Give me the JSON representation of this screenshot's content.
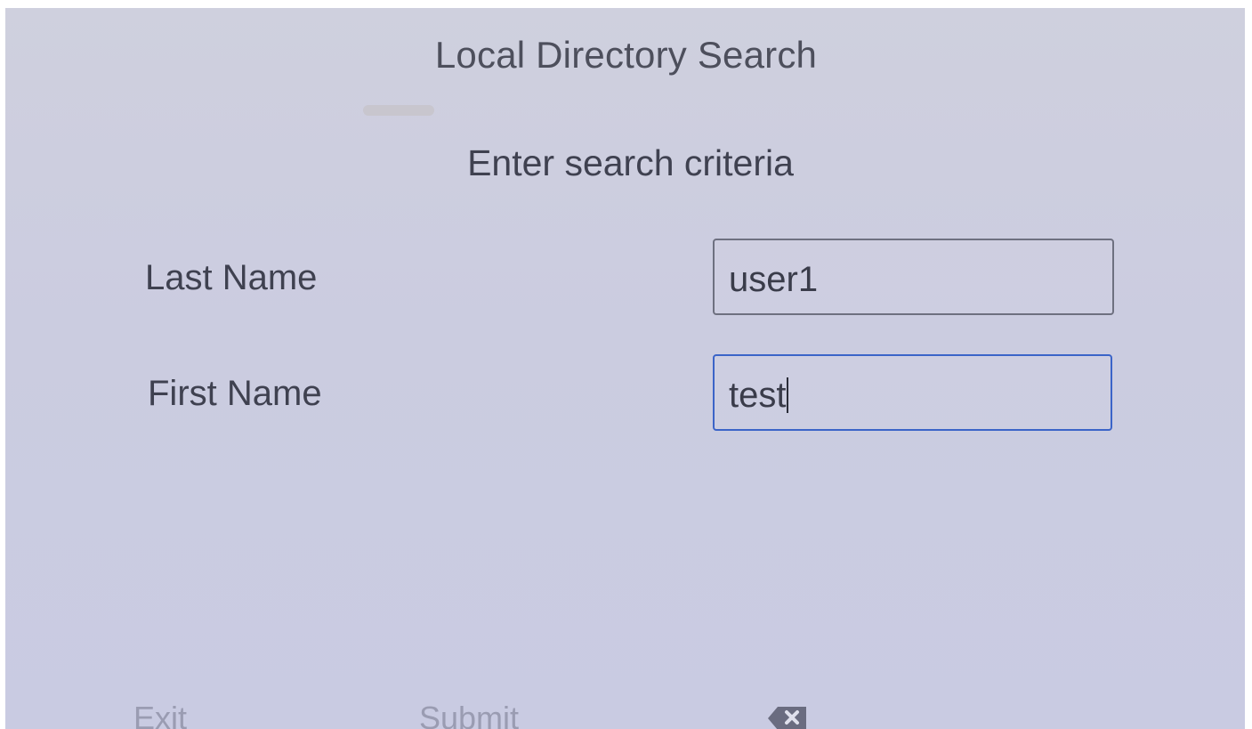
{
  "screen": {
    "title": "Local Directory Search",
    "subtitle": "Enter search criteria"
  },
  "form": {
    "last_name": {
      "label": "Last Name",
      "value": "user1"
    },
    "first_name": {
      "label": "First Name",
      "value": "test"
    }
  },
  "softkeys": {
    "exit": "Exit",
    "submit": "Submit",
    "backspace_icon": "backspace-icon"
  },
  "colors": {
    "active_field_border": "#3b64c8",
    "background": "#cbcce0"
  }
}
